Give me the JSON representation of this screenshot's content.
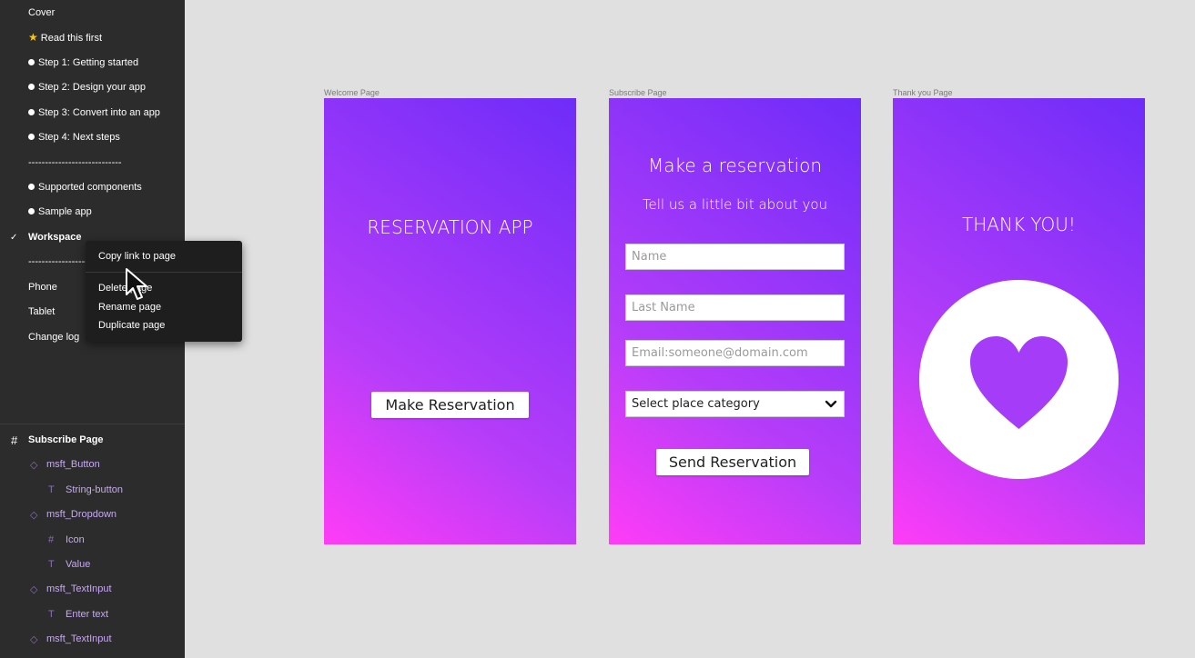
{
  "sidebar": {
    "pages": [
      {
        "label": "Cover",
        "prefix": "none"
      },
      {
        "label": "Read this first",
        "prefix": "star"
      },
      {
        "label": "Step 1: Getting started",
        "prefix": "bullet"
      },
      {
        "label": "Step 2: Design your app",
        "prefix": "bullet"
      },
      {
        "label": "Step 3: Convert into an app",
        "prefix": "bullet"
      },
      {
        "label": "Step 4: Next steps",
        "prefix": "bullet"
      },
      {
        "label": "----------------------------",
        "prefix": "none"
      },
      {
        "label": "Supported components",
        "prefix": "bullet"
      },
      {
        "label": "Sample app",
        "prefix": "bullet"
      },
      {
        "label": "Workspace",
        "prefix": "check"
      },
      {
        "label": "----------------------------",
        "prefix": "none"
      },
      {
        "label": "Phone",
        "prefix": "none"
      },
      {
        "label": "Tablet",
        "prefix": "none"
      },
      {
        "label": "Change log",
        "prefix": "none"
      }
    ],
    "layers": [
      {
        "label": "Subscribe Page",
        "icon": "frame-icon",
        "indent": 0
      },
      {
        "label": "msft_Button",
        "icon": "component-icon",
        "indent": 1
      },
      {
        "label": "String-button",
        "icon": "text-icon",
        "indent": 2
      },
      {
        "label": "msft_Dropdown",
        "icon": "component-icon",
        "indent": 1
      },
      {
        "label": "Icon",
        "icon": "frame-icon",
        "indent": 2
      },
      {
        "label": "Value",
        "icon": "text-icon",
        "indent": 2
      },
      {
        "label": "msft_TextInput",
        "icon": "component-icon",
        "indent": 1
      },
      {
        "label": "Enter text",
        "icon": "text-icon",
        "indent": 2
      },
      {
        "label": "msft_TextInput",
        "icon": "component-icon",
        "indent": 1
      }
    ]
  },
  "context_menu": {
    "copy_link": "Copy link to page",
    "delete": "Delete page",
    "rename": "Rename page",
    "duplicate": "Duplicate page"
  },
  "canvas": {
    "welcome": {
      "frame_title": "Welcome Page",
      "title": "RESERVATION APP",
      "button": "Make Reservation"
    },
    "subscribe": {
      "frame_title": "Subscribe Page",
      "title": "Make a reservation",
      "subtitle": "Tell us a little bit about you",
      "name_placeholder": "Name",
      "lastname_placeholder": "Last Name",
      "email_placeholder": "Email:someone@domain.com",
      "dropdown_value": "Select place category",
      "button": "Send Reservation"
    },
    "thankyou": {
      "frame_title": "Thank you Page",
      "title": "THANK YOU!"
    }
  },
  "colors": {
    "gradient_pink": "#ff3cf7",
    "gradient_purple": "#6e2cf9",
    "heart": "#a43cf8",
    "sidebar_bg": "#2c2c2c",
    "canvas_bg": "#e0e0e0"
  }
}
